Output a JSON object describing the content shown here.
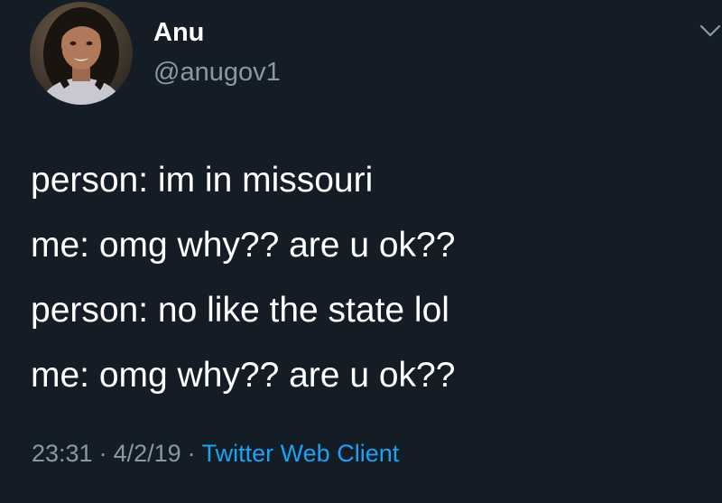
{
  "user": {
    "display_name": "Anu",
    "handle": "@anugov1"
  },
  "tweet": {
    "lines": [
      "person: im in missouri",
      "me: omg why?? are u ok??",
      "person: no like the state lol",
      "me: omg why?? are u ok??"
    ],
    "time": "23:31",
    "date": "4/2/19",
    "separator": "·",
    "client": "Twitter Web Client"
  },
  "icons": {
    "menu": "chevron-down-icon"
  },
  "colors": {
    "background": "#141d26",
    "text": "#ffffff",
    "secondary": "#8899a6",
    "link": "#1da1f2"
  }
}
